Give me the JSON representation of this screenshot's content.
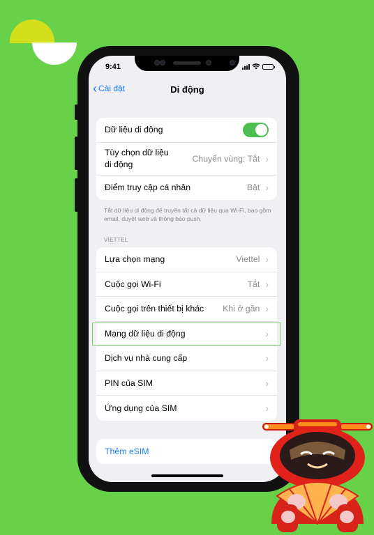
{
  "status_bar": {
    "time": "9:41"
  },
  "nav": {
    "back_label": "Cài đặt",
    "title": "Di động"
  },
  "group1": {
    "cellular_data": {
      "label": "Dữ liệu di động",
      "enabled": true
    },
    "data_options": {
      "label_line1": "Tùy chọn dữ liệu",
      "label_line2": "di động",
      "value": "Chuyển vùng: Tắt"
    },
    "hotspot": {
      "label": "Điểm truy cập cá nhân",
      "value": "Bật"
    }
  },
  "footnote": "Tắt dữ liệu di động để truyền tất cả dữ liệu qua Wi-Fi, bao gồm email, duyệt web và thông báo push.",
  "carrier_section": {
    "header": "VIETTEL",
    "rows": [
      {
        "label": "Lựa chọn mạng",
        "value": "Viettel"
      },
      {
        "label": "Cuộc gọi Wi-Fi",
        "value": "Tắt"
      },
      {
        "label": "Cuộc gọi trên thiết bị khác",
        "value": "Khi ở gần"
      },
      {
        "label": "Mạng dữ liệu di động",
        "value": ""
      },
      {
        "label": "Dịch vụ nhà cung cấp",
        "value": ""
      },
      {
        "label": "PIN của SIM",
        "value": ""
      },
      {
        "label": "Ứng dụng của SIM",
        "value": ""
      }
    ]
  },
  "esim": {
    "label": "Thêm eSIM"
  },
  "colors": {
    "background": "#67d14a",
    "accent": "#1a7cff",
    "toggle_on": "#4dbf52",
    "highlight": "#7cd06c"
  }
}
